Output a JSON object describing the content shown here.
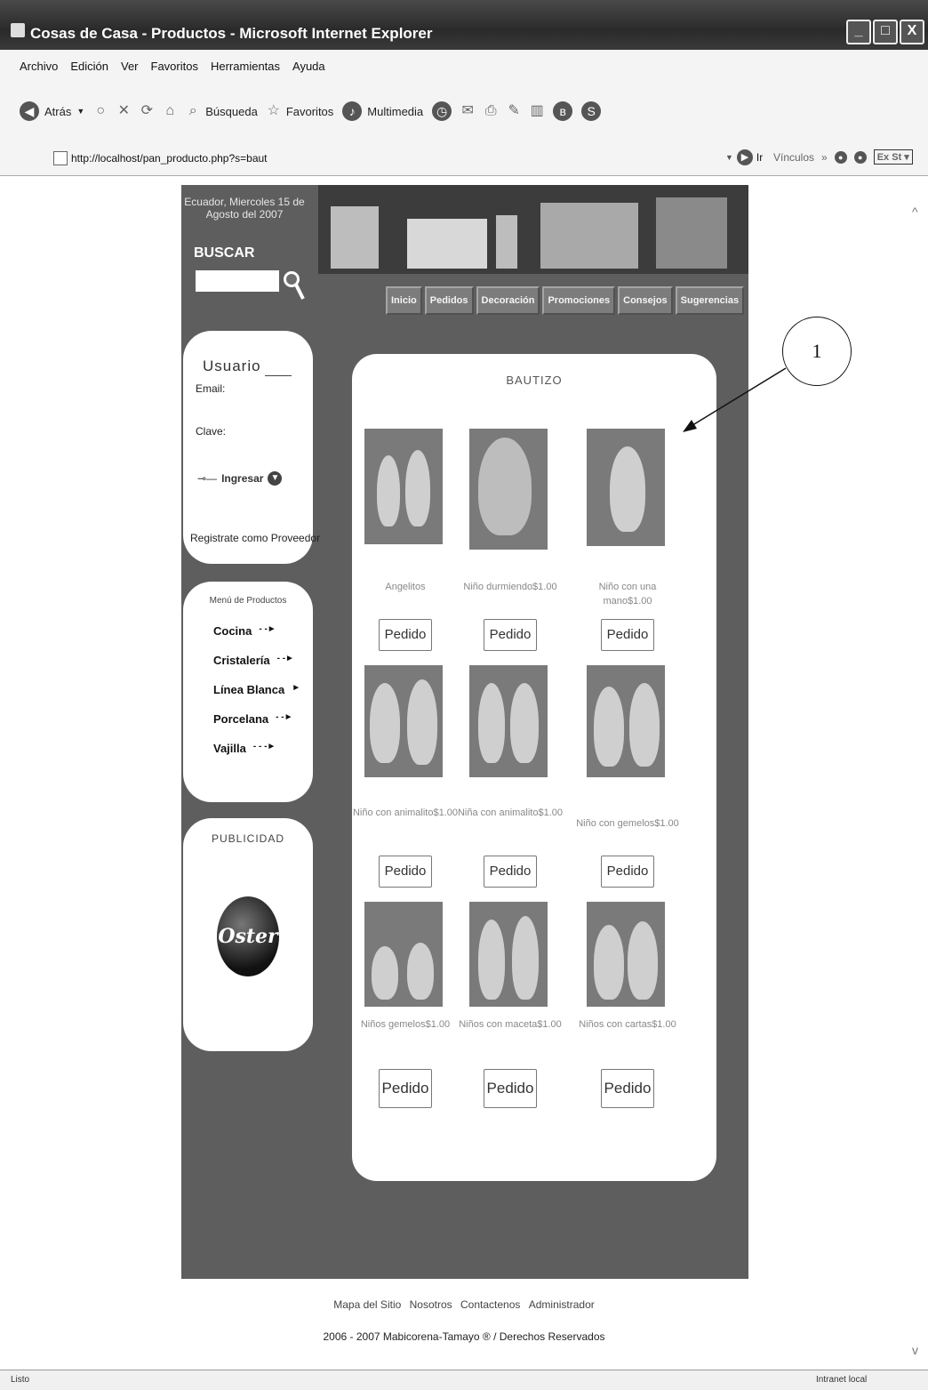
{
  "window": {
    "title": "Cosas de Casa - Productos - Microsoft Internet Explorer",
    "buttons": [
      "_",
      "□",
      "X"
    ]
  },
  "menubar": [
    "Archivo",
    "Edición",
    "Ver",
    "Favoritos",
    "Herramientas",
    "Ayuda"
  ],
  "toolbar": {
    "back": "Atrás",
    "search": "Búsqueda",
    "favorites": "Favoritos",
    "multimedia": "Multimedia"
  },
  "address": {
    "url": "http://localhost/pan_producto.php?s=baut",
    "go": "Ir",
    "links": "Vínculos",
    "ext": "Ex St"
  },
  "site": {
    "date": "Ecuador, Miercoles 15 de Agosto del 2007",
    "search_label": "BUSCAR",
    "nav": [
      "Inicio",
      "Pedidos",
      "Decoración",
      "Promociones",
      "Consejos",
      "Sugerencias"
    ],
    "login": {
      "title": "Usuario",
      "email_label": "Email:",
      "password_label": "Clave:",
      "submit": "Ingresar",
      "register": "Registrate como Proveedor"
    },
    "product_menu": {
      "title": "Menú de Productos",
      "items": [
        "Cocina",
        "Cristalería",
        "Línea Blanca",
        "Porcelana",
        "Vajilla"
      ]
    },
    "ads": {
      "title": "PUBLICIDAD",
      "brand": "Oster"
    },
    "products": {
      "category": "BAUTIZO",
      "items": [
        {
          "name": "Angelitos",
          "button": "Pedido"
        },
        {
          "name": "Niño durmiendo$1.00",
          "button": "Pedido"
        },
        {
          "name": "Niño con una mano$1.00",
          "button": "Pedido"
        },
        {
          "name": "Niño con animalito$1.00",
          "button": "Pedido"
        },
        {
          "name": "Niña con animalito$1.00",
          "button": "Pedido"
        },
        {
          "name": "Niño con gemelos$1.00",
          "button": "Pedido"
        },
        {
          "name": "Niños gemelos$1.00",
          "button": "Pedido"
        },
        {
          "name": "Niños con maceta$1.00",
          "button": "Pedido"
        },
        {
          "name": "Niños con cartas$1.00",
          "button": "Pedido"
        }
      ]
    },
    "footer": {
      "links": [
        "Mapa del Sitio",
        "Nosotros",
        "Contactenos",
        "Administrador"
      ],
      "copyright": "2006 - 2007 Mabicorena-Tamayo ® / Derechos Reservados"
    }
  },
  "annotation": {
    "label": "1"
  },
  "status": {
    "left": "Listo",
    "right": "Intranet local"
  }
}
